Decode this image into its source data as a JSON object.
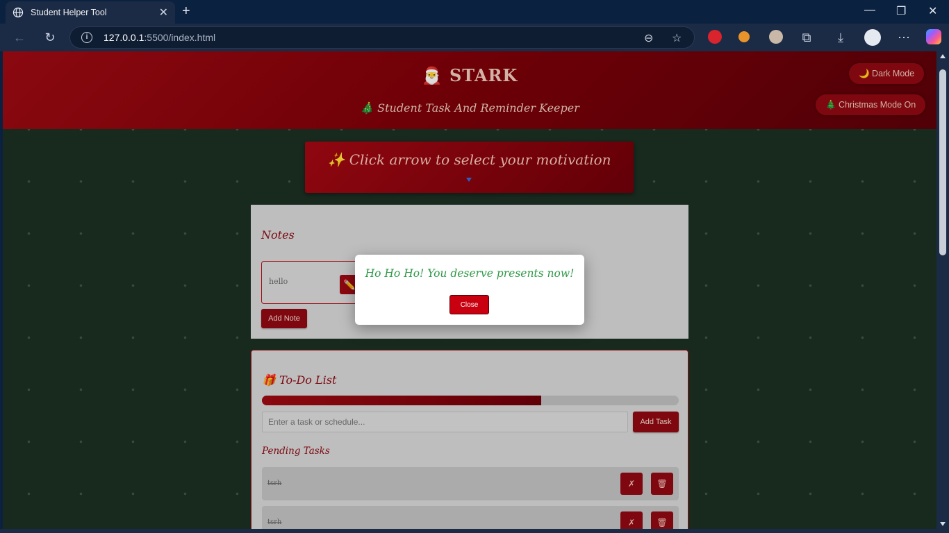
{
  "browser": {
    "tab_title": "Student Helper Tool",
    "tab_close": "✕",
    "new_tab": "+",
    "url_host": "127.0.0.1",
    "url_path": ":5500/index.html"
  },
  "header": {
    "title": "🎅 STARK",
    "subtitle": "🎄 Student Task And Reminder Keeper",
    "dark_mode_btn": "🌙 Dark Mode",
    "christmas_btn": "🎄 Christmas Mode On"
  },
  "motivation": {
    "text": "✨ Click arrow to select your motivation"
  },
  "notes": {
    "title": "Notes",
    "items": [
      {
        "text": "hello",
        "edit_icon": "✏️"
      }
    ],
    "add_button": "Add Note"
  },
  "todo": {
    "title": "🎁 To-Do List",
    "progress": 0.67,
    "input_placeholder": "Enter a task or schedule...",
    "add_button": "Add Task",
    "pending_title": "Pending Tasks",
    "tasks": [
      {
        "text": "tsrh",
        "complete_icon": "✗",
        "delete_icon": "🗑"
      },
      {
        "text": "tsrh",
        "complete_icon": "✗",
        "delete_icon": "🗑"
      }
    ]
  },
  "modal": {
    "message": "Ho Ho Ho! You deserve presents now!",
    "close_button": "Close"
  },
  "colors": {
    "accent_red": "#8e0a12",
    "page_bg": "#1b2e22",
    "modal_text": "#2f9a47"
  }
}
